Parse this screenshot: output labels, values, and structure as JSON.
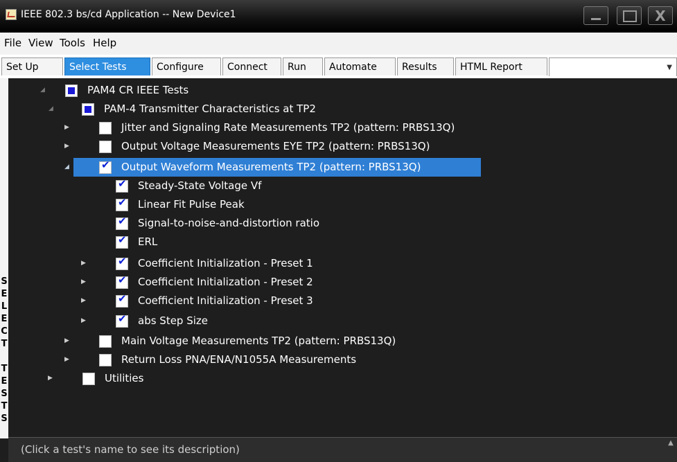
{
  "window": {
    "title": "IEEE 802.3 bs/cd Application -- New Device1"
  },
  "menu": [
    "File",
    "View",
    "Tools",
    "Help"
  ],
  "tabs": [
    "Set Up",
    "Select Tests",
    "Configure",
    "Connect",
    "Run",
    "Automate",
    "Results",
    "HTML Report"
  ],
  "active_tab": "Select Tests",
  "sidebar": {
    "label": [
      "S",
      "E",
      "L",
      "E",
      "C",
      "T",
      "",
      "T",
      "E",
      "S",
      "T",
      "S"
    ]
  },
  "tree": [
    {
      "label": "PAM4 CR IEEE Tests",
      "state": "partial",
      "expanded": true
    },
    {
      "label": "PAM-4 Transmitter Characteristics at TP2",
      "state": "partial",
      "expanded": true
    },
    {
      "label": "Jitter and Signaling Rate Measurements TP2 (pattern: PRBS13Q)",
      "state": "unchecked",
      "expanded": false
    },
    {
      "label": "Output Voltage Measurements EYE TP2 (pattern: PRBS13Q)",
      "state": "unchecked",
      "expanded": false
    },
    {
      "label": "Output Waveform Measurements TP2 (pattern: PRBS13Q)",
      "state": "checked",
      "expanded": true,
      "selected": true
    },
    {
      "label": "Steady-State Voltage Vf",
      "state": "checked"
    },
    {
      "label": "Linear Fit Pulse Peak",
      "state": "checked"
    },
    {
      "label": "Signal-to-noise-and-distortion ratio",
      "state": "checked"
    },
    {
      "label": "ERL",
      "state": "checked"
    },
    {
      "label": "Coefficient Initialization - Preset 1",
      "state": "checked",
      "expanded": false
    },
    {
      "label": "Coefficient Initialization - Preset 2",
      "state": "checked",
      "expanded": false
    },
    {
      "label": "Coefficient Initialization - Preset 3",
      "state": "checked",
      "expanded": false
    },
    {
      "label": "abs Step Size",
      "state": "checked",
      "expanded": false
    },
    {
      "label": "Main Voltage Measurements TP2 (pattern: PRBS13Q)",
      "state": "unchecked",
      "expanded": false
    },
    {
      "label": "Return Loss PNA/ENA/N1055A Measurements",
      "state": "unchecked",
      "expanded": false
    },
    {
      "label": "Utilities",
      "state": "unchecked",
      "expanded": false
    }
  ],
  "description": {
    "text": "(Click a test's name to see its description)"
  }
}
